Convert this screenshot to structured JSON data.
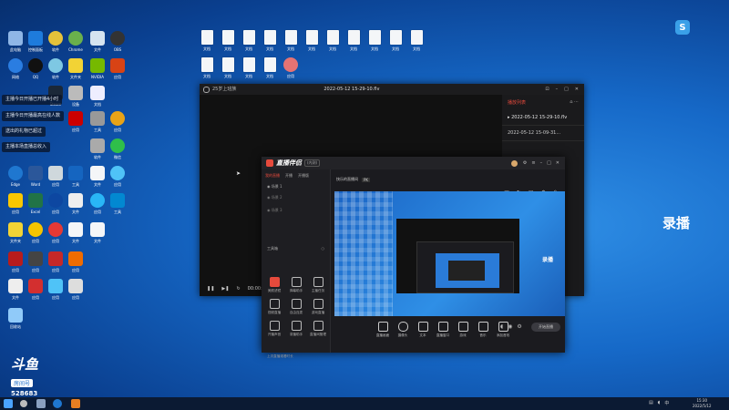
{
  "desktop": {
    "notifications": [
      "主播今日开播已开播4小时",
      "主播今日开播最高在线人数",
      "送出的礼物已超过",
      "主播本场直播总收入"
    ],
    "big_label": "录播",
    "watermark": {
      "brand": "斗鱼",
      "sub": "房间号",
      "room": "528683"
    }
  },
  "window_player": {
    "title": "25岁上班族",
    "center_title": "2022-05-12 15-29-10.flv",
    "time": "00:00:00 / 00",
    "sidebar": {
      "header": "播放列表",
      "items": [
        "2022-05-12 15-29-10.flv",
        "2022-05-12 15-09-31..."
      ]
    }
  },
  "window_studio": {
    "brand": "直播伴侣",
    "badge": "(内测)",
    "left_tabs": [
      "我的直播",
      "开播",
      "开播版"
    ],
    "scenes": [
      "场景 1",
      "场景 2",
      "场景 3"
    ],
    "tools_title": "工具箱",
    "tools": [
      "美颜滤镜",
      "弹幕助手",
      "主播任务",
      "视频直播",
      "自由连麦",
      "游戏直播",
      "开播声音",
      "录播助手",
      "直播间管理",
      "活动中心",
      "应用商店",
      "更多"
    ],
    "scene_header": "快乐的直播间",
    "scene_tag": "PK",
    "bottom_tools": [
      "直播画面",
      "摄像头",
      "文本",
      "直播窗口",
      "游戏",
      "音乐",
      "添加音效"
    ],
    "start_button": "开始直播",
    "footer_status": "上次直播观看时长"
  },
  "colors": {
    "accent": "#e64a3c",
    "desktop": "#1669c8"
  }
}
